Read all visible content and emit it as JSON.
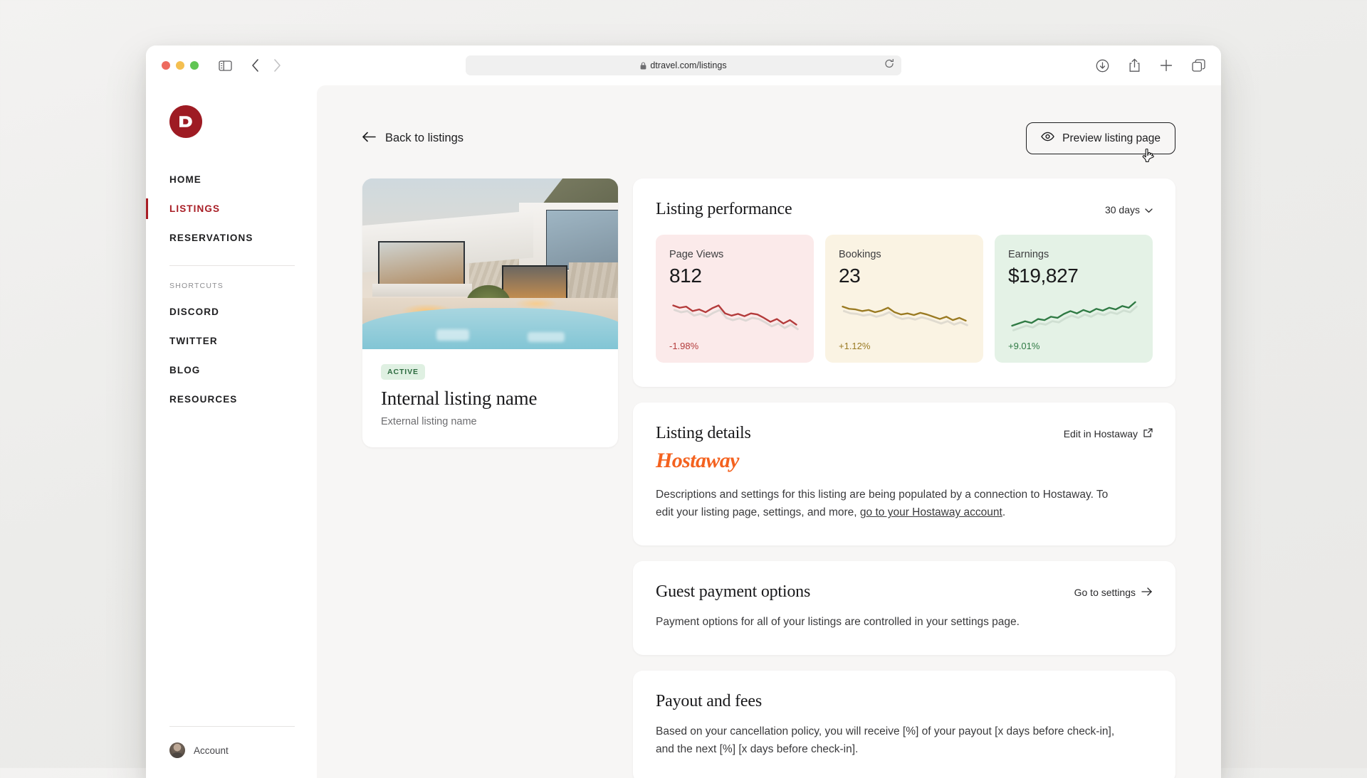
{
  "browser": {
    "url": "dtravel.com/listings",
    "icons": {
      "sidebar_toggle": "sidebar-toggle-icon",
      "back": "chevron-left-icon",
      "forward": "chevron-right-icon",
      "shield": "shield-icon",
      "lock": "lock-icon",
      "reload": "reload-icon",
      "download": "download-icon",
      "share": "share-icon",
      "new_tab": "plus-icon",
      "tabs": "tabs-icon"
    }
  },
  "sidebar": {
    "logo_letter": "D",
    "brand_color": "#9e1b23",
    "nav": [
      {
        "label": "HOME",
        "active": false
      },
      {
        "label": "LISTINGS",
        "active": true
      },
      {
        "label": "RESERVATIONS",
        "active": false
      }
    ],
    "shortcuts_label": "SHORTCUTS",
    "shortcuts": [
      {
        "label": "DISCORD"
      },
      {
        "label": "TWITTER"
      },
      {
        "label": "BLOG"
      },
      {
        "label": "RESOURCES"
      }
    ],
    "account_label": "Account"
  },
  "header": {
    "back_label": "Back to listings",
    "preview_label": "Preview listing page",
    "preview_icon": "eye-icon",
    "back_icon": "arrow-left-icon"
  },
  "listing": {
    "status": "ACTIVE",
    "status_color": "#2c6b3f",
    "internal_name": "Internal listing name",
    "external_name": "External listing name",
    "photo_alt": "modern villa with pool at dusk"
  },
  "performance": {
    "title": "Listing performance",
    "period": "30 days",
    "metrics": [
      {
        "label": "Page Views",
        "value": "812",
        "delta": "-1.98%",
        "trend": "down",
        "color": "#b33b3b"
      },
      {
        "label": "Bookings",
        "value": "23",
        "delta": "+1.12%",
        "trend": "down",
        "color": "#9a7a22"
      },
      {
        "label": "Earnings",
        "value": "$19,827",
        "delta": "+9.01%",
        "trend": "up",
        "color": "#2f7a44"
      }
    ]
  },
  "details": {
    "title": "Listing details",
    "action_label": "Edit in Hostaway",
    "action_icon": "external-link-icon",
    "provider_logo": "Hostaway",
    "provider_color": "#f4621f",
    "body_before_link": "Descriptions and settings for this listing are being populated by a connection to Hostaway. To edit your listing page, settings, and more, ",
    "link_text": "go to your Hostaway account",
    "body_after_link": "."
  },
  "payment": {
    "title": "Guest payment options",
    "action_label": "Go to settings",
    "action_icon": "arrow-right-icon",
    "body": "Payment options for all of your listings are controlled in your settings page."
  },
  "payout": {
    "title": "Payout and fees",
    "body": "Based on your cancellation policy, you will receive [%] of your payout [x days before check-in], and the next [%] [x days before check-in]."
  },
  "chart_data": [
    {
      "type": "line",
      "title": "Page Views",
      "values": [
        62,
        58,
        60,
        52,
        55,
        50,
        57,
        62,
        48,
        44,
        47,
        43,
        48,
        46,
        40,
        33,
        38,
        30,
        36,
        28
      ],
      "ylim": [
        20,
        70
      ],
      "color": "#b33b3b",
      "summary_value": 812,
      "delta_pct": -1.98
    },
    {
      "type": "line",
      "title": "Bookings",
      "values": [
        60,
        56,
        55,
        52,
        54,
        50,
        53,
        58,
        50,
        46,
        48,
        45,
        49,
        46,
        42,
        38,
        42,
        36,
        40,
        35
      ],
      "ylim": [
        20,
        70
      ],
      "color": "#9a7a22",
      "summary_value": 23,
      "delta_pct": 1.12
    },
    {
      "type": "line",
      "title": "Earnings",
      "values": [
        26,
        30,
        34,
        31,
        38,
        36,
        42,
        40,
        47,
        52,
        48,
        54,
        50,
        56,
        53,
        58,
        55,
        61,
        58,
        68
      ],
      "ylim": [
        20,
        70
      ],
      "color": "#2f7a44",
      "summary_value": 19827,
      "delta_pct": 9.01
    }
  ]
}
